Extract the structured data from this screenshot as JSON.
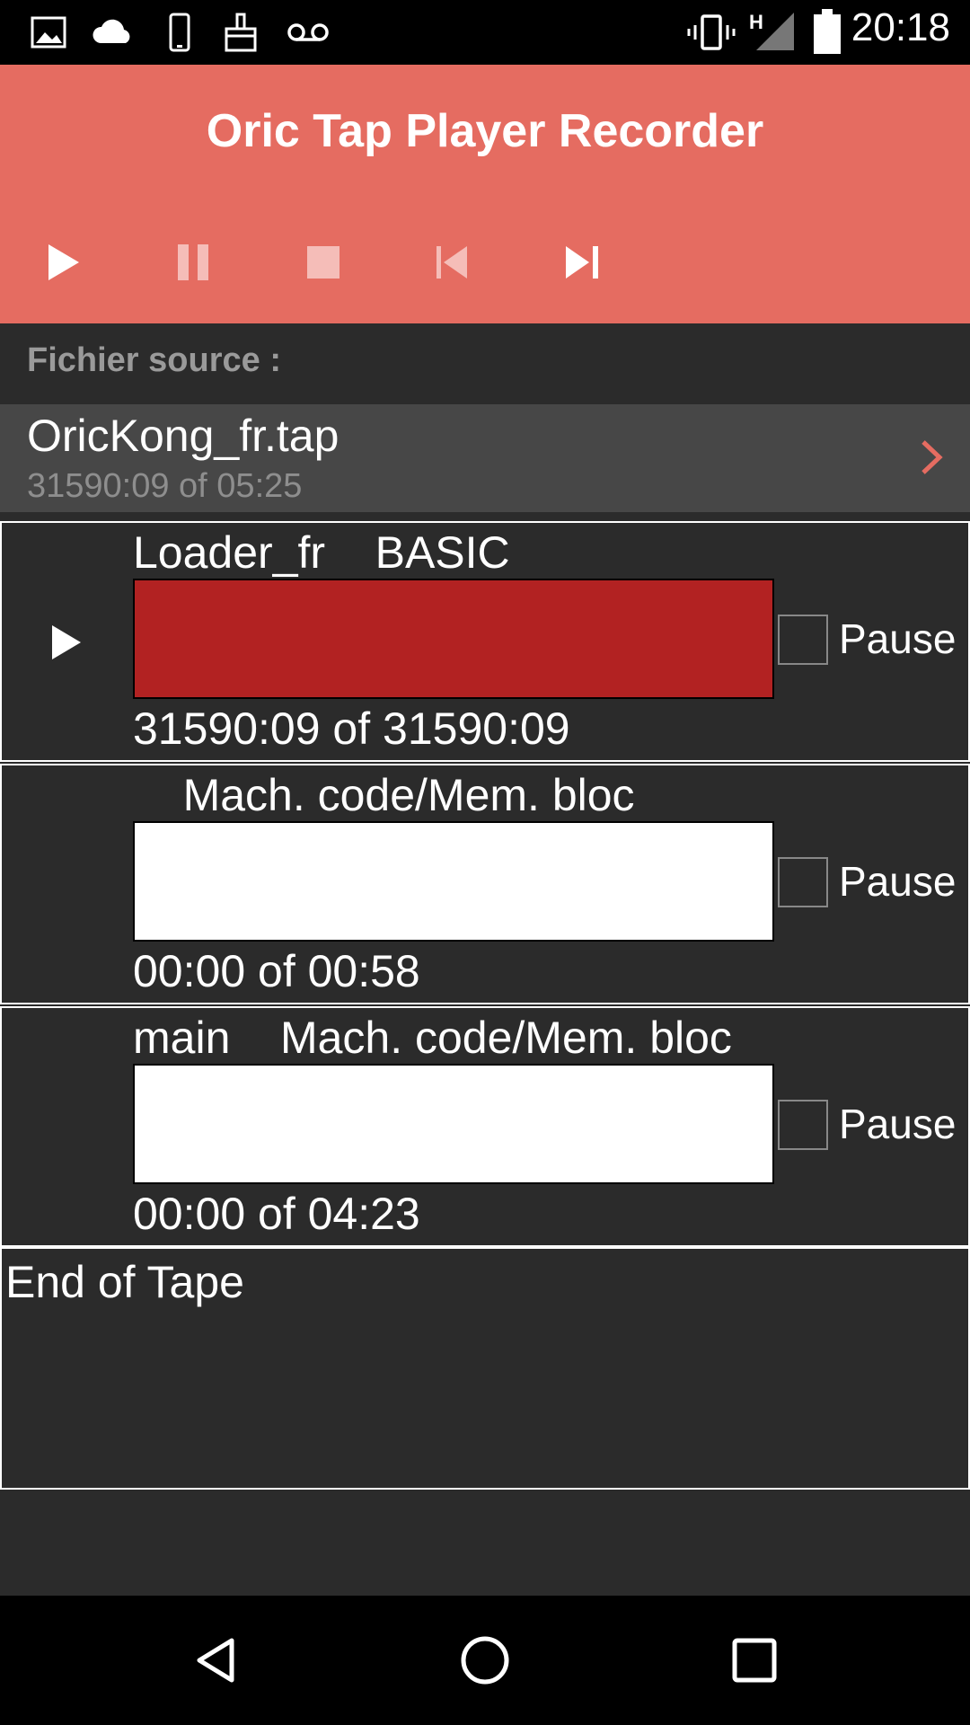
{
  "status_bar": {
    "time": "20:18",
    "icons": [
      "image-icon",
      "cloud-icon",
      "phone-icon",
      "brush-icon",
      "voicemail-icon",
      "vibrate-icon",
      "signal-h-icon",
      "battery-icon"
    ],
    "network_label": "H"
  },
  "app_bar": {
    "title": "Oric Tap Player  Recorder",
    "background": "#e56c61",
    "controls": [
      "play-icon",
      "pause-icon",
      "stop-icon",
      "skip-previous-icon",
      "skip-next-icon"
    ]
  },
  "source": {
    "label": "Fichier source :",
    "file_name": "OricKong_fr.tap",
    "file_time": "31590:09 of 05:25"
  },
  "blocks": [
    {
      "title": "Loader_fr    BASIC",
      "time": "31590:09 of 31590:09",
      "pause_label": "Pause",
      "progress": 1.0,
      "progress_color": "#b22222",
      "playing": true
    },
    {
      "title": "    Mach. code/Mem. bloc",
      "time": "00:00 of 00:58",
      "pause_label": "Pause",
      "progress": 0.0,
      "playing": false
    },
    {
      "title": "main    Mach. code/Mem. bloc",
      "time": "00:00 of 04:23",
      "pause_label": "Pause",
      "progress": 0.0,
      "playing": false
    }
  ],
  "end_of_tape": "End of Tape",
  "nav_bar": [
    "back-icon",
    "home-icon",
    "recents-icon"
  ]
}
